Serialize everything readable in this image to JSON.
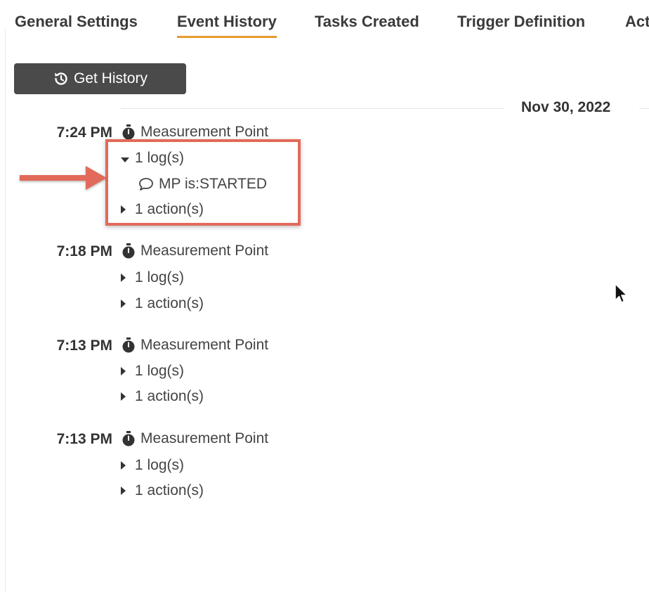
{
  "tabs": [
    {
      "label": "General Settings",
      "active": false
    },
    {
      "label": "Event History",
      "active": true
    },
    {
      "label": "Tasks Created",
      "active": false
    },
    {
      "label": "Trigger Definition",
      "active": false
    },
    {
      "label": "Act",
      "active": false
    }
  ],
  "toolbar": {
    "get_history_label": "Get History",
    "get_history_icon": "history-icon"
  },
  "date_label": "Nov 30, 2022",
  "events": [
    {
      "time": "7:24 PM",
      "title": "Measurement Point",
      "icon": "stopwatch-icon",
      "logs_label": "1 log(s)",
      "logs_expanded": true,
      "log_entries": [
        "MP is:STARTED"
      ],
      "actions_label": "1 action(s)",
      "actions_expanded": false
    },
    {
      "time": "7:18 PM",
      "title": "Measurement Point",
      "icon": "stopwatch-icon",
      "logs_label": "1 log(s)",
      "logs_expanded": false,
      "actions_label": "1 action(s)",
      "actions_expanded": false
    },
    {
      "time": "7:13 PM",
      "title": "Measurement Point",
      "icon": "stopwatch-icon",
      "logs_label": "1 log(s)",
      "logs_expanded": false,
      "actions_label": "1 action(s)",
      "actions_expanded": false
    },
    {
      "time": "7:13 PM",
      "title": "Measurement Point",
      "icon": "stopwatch-icon",
      "logs_label": "1 log(s)",
      "logs_expanded": false,
      "actions_label": "1 action(s)",
      "actions_expanded": false
    }
  ],
  "colors": {
    "active_tab_underline": "#e89b2e",
    "button_bg": "#4a4a4a",
    "annotation": "#e26a5a"
  }
}
